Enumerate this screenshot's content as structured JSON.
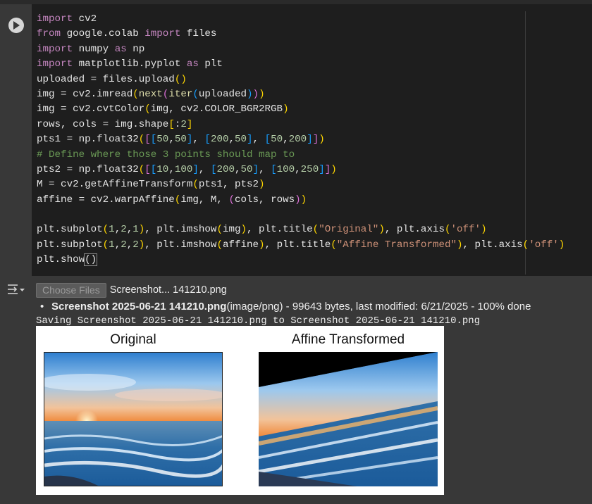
{
  "code_lines": [
    [
      [
        "kw",
        "import"
      ],
      [
        "t",
        " cv2"
      ]
    ],
    [
      [
        "kw",
        "from"
      ],
      [
        "t",
        " google.colab "
      ],
      [
        "kw",
        "import"
      ],
      [
        "t",
        " files"
      ]
    ],
    [
      [
        "kw",
        "import"
      ],
      [
        "t",
        " numpy "
      ],
      [
        "kw",
        "as"
      ],
      [
        "t",
        " np"
      ]
    ],
    [
      [
        "kw",
        "import"
      ],
      [
        "t",
        " matplotlib.pyplot "
      ],
      [
        "kw",
        "as"
      ],
      [
        "t",
        " plt"
      ]
    ],
    [
      [
        "t",
        "uploaded = files.upload"
      ],
      [
        "b1",
        "()"
      ]
    ],
    [
      [
        "t",
        "img = cv2.imread"
      ],
      [
        "b1",
        "("
      ],
      [
        "fn",
        "next"
      ],
      [
        "b2",
        "("
      ],
      [
        "fn",
        "iter"
      ],
      [
        "b3",
        "("
      ],
      [
        "t",
        "uploaded"
      ],
      [
        "b3",
        ")"
      ],
      [
        "b2",
        ")"
      ],
      [
        "b1",
        ")"
      ]
    ],
    [
      [
        "t",
        "img = cv2.cvtColor"
      ],
      [
        "b1",
        "("
      ],
      [
        "t",
        "img, cv2.COLOR_BGR2RGB"
      ],
      [
        "b1",
        ")"
      ]
    ],
    [
      [
        "t",
        "rows, cols = img.shape"
      ],
      [
        "b1",
        "["
      ],
      [
        "t",
        ":"
      ],
      [
        "num",
        "2"
      ],
      [
        "b1",
        "]"
      ]
    ],
    [
      [
        "t",
        "pts1 = np.float32"
      ],
      [
        "b1",
        "("
      ],
      [
        "b2",
        "["
      ],
      [
        "b3",
        "["
      ],
      [
        "num",
        "50"
      ],
      [
        "t",
        ","
      ],
      [
        "num",
        "50"
      ],
      [
        "b3",
        "]"
      ],
      [
        "t",
        ", "
      ],
      [
        "b3",
        "["
      ],
      [
        "num",
        "200"
      ],
      [
        "t",
        ","
      ],
      [
        "num",
        "50"
      ],
      [
        "b3",
        "]"
      ],
      [
        "t",
        ", "
      ],
      [
        "b3",
        "["
      ],
      [
        "num",
        "50"
      ],
      [
        "t",
        ","
      ],
      [
        "num",
        "200"
      ],
      [
        "b3",
        "]"
      ],
      [
        "b2",
        "]"
      ],
      [
        "b1",
        ")"
      ]
    ],
    [
      [
        "cm",
        "# Define where those 3 points should map to"
      ]
    ],
    [
      [
        "t",
        "pts2 = np.float32"
      ],
      [
        "b1",
        "("
      ],
      [
        "b2",
        "["
      ],
      [
        "b3",
        "["
      ],
      [
        "num",
        "10"
      ],
      [
        "t",
        ","
      ],
      [
        "num",
        "100"
      ],
      [
        "b3",
        "]"
      ],
      [
        "t",
        ", "
      ],
      [
        "b3",
        "["
      ],
      [
        "num",
        "200"
      ],
      [
        "t",
        ","
      ],
      [
        "num",
        "50"
      ],
      [
        "b3",
        "]"
      ],
      [
        "t",
        ", "
      ],
      [
        "b3",
        "["
      ],
      [
        "num",
        "100"
      ],
      [
        "t",
        ","
      ],
      [
        "num",
        "250"
      ],
      [
        "b3",
        "]"
      ],
      [
        "b2",
        "]"
      ],
      [
        "b1",
        ")"
      ]
    ],
    [
      [
        "t",
        "M = cv2.getAffineTransform"
      ],
      [
        "b1",
        "("
      ],
      [
        "t",
        "pts1, pts2"
      ],
      [
        "b1",
        ")"
      ]
    ],
    [
      [
        "t",
        "affine = cv2.warpAffine"
      ],
      [
        "b1",
        "("
      ],
      [
        "t",
        "img, M, "
      ],
      [
        "b2",
        "("
      ],
      [
        "t",
        "cols, rows"
      ],
      [
        "b2",
        ")"
      ],
      [
        "b1",
        ")"
      ]
    ],
    [],
    [
      [
        "t",
        "plt.subplot"
      ],
      [
        "b1",
        "("
      ],
      [
        "num",
        "1"
      ],
      [
        "t",
        ","
      ],
      [
        "num",
        "2"
      ],
      [
        "t",
        ","
      ],
      [
        "num",
        "1"
      ],
      [
        "b1",
        ")"
      ],
      [
        "t",
        ", plt.imshow"
      ],
      [
        "b1",
        "("
      ],
      [
        "t",
        "img"
      ],
      [
        "b1",
        ")"
      ],
      [
        "t",
        ", plt.title"
      ],
      [
        "b1",
        "("
      ],
      [
        "str",
        "\"Original\""
      ],
      [
        "b1",
        ")"
      ],
      [
        "t",
        ", plt.axis"
      ],
      [
        "b1",
        "("
      ],
      [
        "str",
        "'off'"
      ],
      [
        "b1",
        ")"
      ]
    ],
    [
      [
        "t",
        "plt.subplot"
      ],
      [
        "b1",
        "("
      ],
      [
        "num",
        "1"
      ],
      [
        "t",
        ","
      ],
      [
        "num",
        "2"
      ],
      [
        "t",
        ","
      ],
      [
        "num",
        "2"
      ],
      [
        "b1",
        ")"
      ],
      [
        "t",
        ", plt.imshow"
      ],
      [
        "b1",
        "("
      ],
      [
        "t",
        "affine"
      ],
      [
        "b1",
        ")"
      ],
      [
        "t",
        ", plt.title"
      ],
      [
        "b1",
        "("
      ],
      [
        "str",
        "\"Affine Transformed\""
      ],
      [
        "b1",
        ")"
      ],
      [
        "t",
        ", plt.axis"
      ],
      [
        "b1",
        "("
      ],
      [
        "str",
        "'off'"
      ],
      [
        "b1",
        ")"
      ]
    ],
    [
      [
        "t",
        "plt.show"
      ],
      [
        "bm",
        "()"
      ]
    ]
  ],
  "output": {
    "choose_files_label": "Choose Files",
    "selected_file": "Screenshot... 141210.png",
    "file_name": "Screenshot 2025-06-21 141210.png",
    "file_details": "(image/png) - 99643 bytes, last modified: 6/21/2025 - 100% done",
    "saving_line": "Saving Screenshot 2025-06-21 141210.png to Screenshot 2025-06-21 141210.png"
  },
  "figure": {
    "title_left": "Original",
    "title_right": "Affine Transformed"
  },
  "colors": {
    "keyword": "#c586c0",
    "number": "#b5cea8",
    "string": "#ce9178",
    "comment": "#6a9955",
    "bracket_1": "#ffd700",
    "bracket_2": "#da70d6",
    "bracket_3": "#179fff"
  }
}
